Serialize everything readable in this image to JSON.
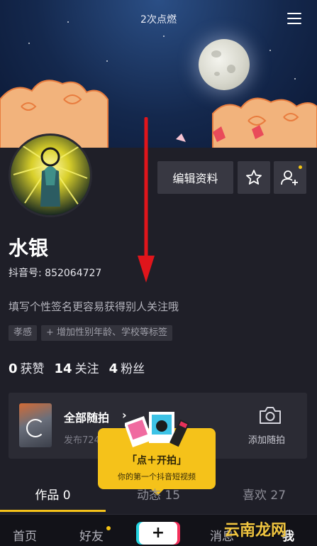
{
  "header": {
    "title": "2次点燃"
  },
  "profile": {
    "edit_label": "编辑资料",
    "name": "水银",
    "douyin_id": "抖音号: 852064727",
    "bio": "填写个性签名更容易获得别人关注哦",
    "tags": [
      "孝感",
      "+ 增加性别年龄、学校等标签"
    ],
    "stats": [
      {
        "num": "0",
        "label": "获赞"
      },
      {
        "num": "14",
        "label": "关注"
      },
      {
        "num": "4",
        "label": "粉丝"
      }
    ]
  },
  "quick_shot": {
    "title": "全部随拍",
    "subtitle": "发布724",
    "add_label": "添加随拍"
  },
  "popup": {
    "title": "「点＋开拍」",
    "subtitle": "你的第一个抖音短视频"
  },
  "tabs": [
    {
      "label": "作品 0"
    },
    {
      "label": "动态 15"
    },
    {
      "label": "喜欢 27"
    }
  ],
  "bottom_nav": [
    {
      "label": "首页"
    },
    {
      "label": "好友"
    },
    {
      "label": "消息"
    },
    {
      "label": "我"
    }
  ],
  "watermark": "云南龙网",
  "colors": {
    "accent": "#f5c21a",
    "panel": "#1f1f28",
    "arrow": "#e0151b"
  }
}
